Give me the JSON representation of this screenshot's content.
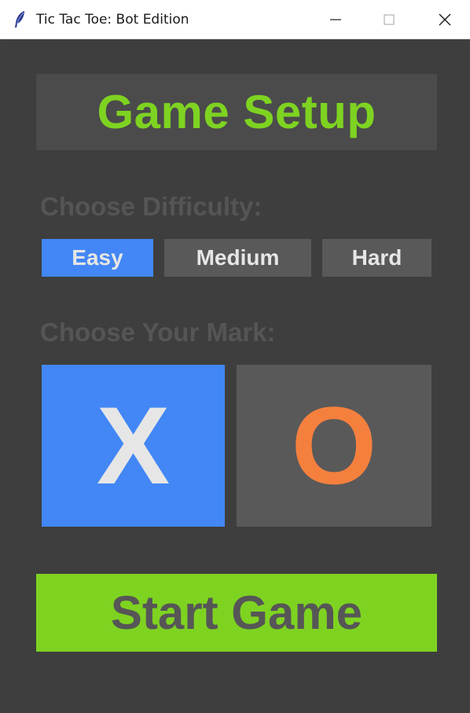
{
  "window": {
    "title": "Tic Tac Toe: Bot Edition",
    "icon": "feather-icon",
    "controls": [
      "minimize-icon",
      "maximize-icon",
      "close-icon"
    ]
  },
  "setup": {
    "title": "Game Setup"
  },
  "difficulty": {
    "label": "Choose Difficulty:",
    "options": [
      {
        "label": "Easy",
        "selected": true
      },
      {
        "label": "Medium",
        "selected": false
      },
      {
        "label": "Hard",
        "selected": false
      }
    ]
  },
  "mark": {
    "label": "Choose Your Mark:",
    "options": [
      {
        "label": "X",
        "selected": true
      },
      {
        "label": "O",
        "selected": false
      }
    ]
  },
  "start": {
    "label": "Start Game"
  },
  "colors": {
    "accent_green": "#7ed321",
    "selected_blue": "#4287f5",
    "o_orange": "#f5803e",
    "background": "#3e3e3e",
    "panel": "#4b4b4b",
    "button": "#595959"
  }
}
